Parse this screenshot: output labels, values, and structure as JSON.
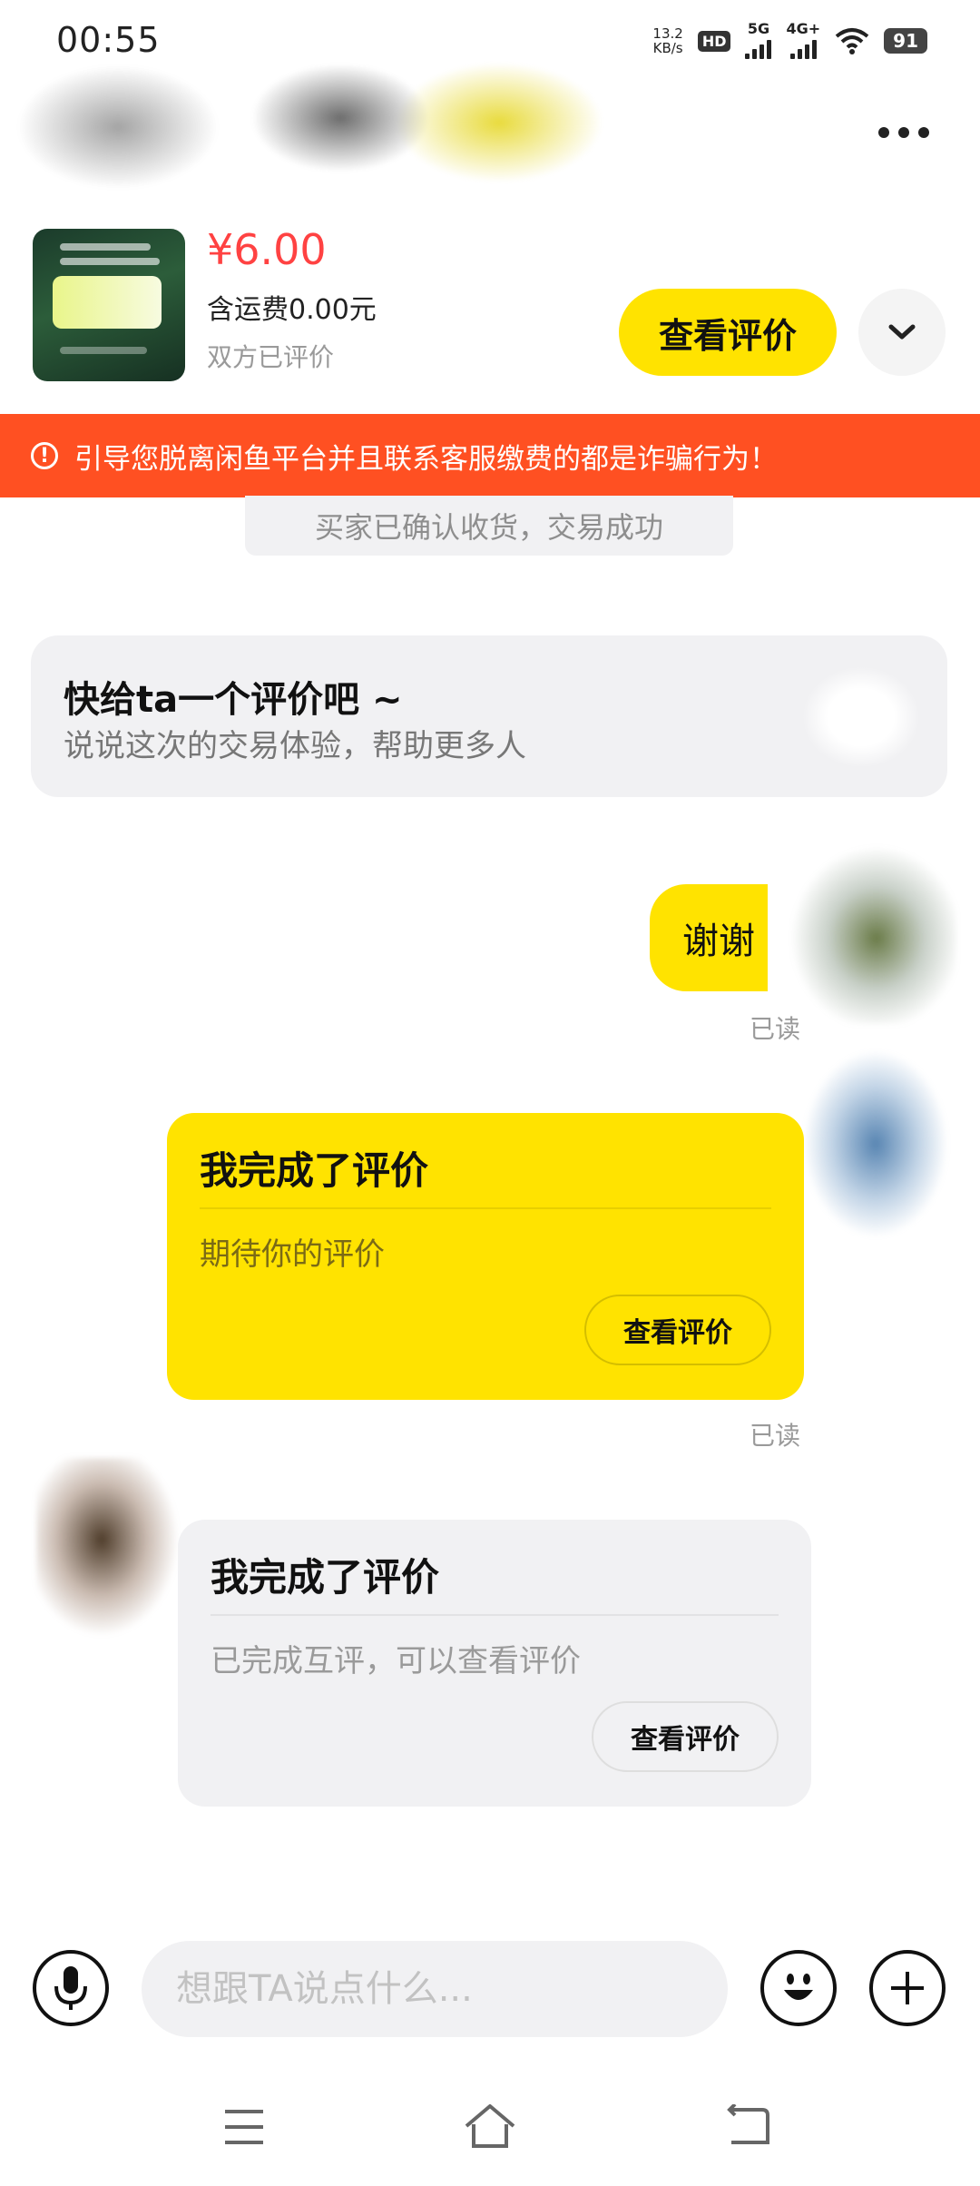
{
  "status_bar": {
    "time": "00:55",
    "net_speed_value": "13.2",
    "net_speed_unit": "KB/s",
    "hd_badge": "HD",
    "signal_1_label": "5G",
    "signal_2_label": "4G+",
    "battery": "91"
  },
  "product": {
    "price": "¥6.00",
    "shipping": "含运费0.00元",
    "status": "双方已评价",
    "view_review_label": "查看评价"
  },
  "warning": {
    "text": "引导您脱离闲鱼平台并且联系客服缴费的都是诈骗行为！"
  },
  "system_notice": "买家已确认收货，交易成功",
  "prompt_card": {
    "title": "快给ta一个评价吧 ~",
    "subtitle": "说说这次的交易体验，帮助更多人"
  },
  "messages": {
    "text_message": "谢谢",
    "read_label_1": "已读",
    "my_review_card": {
      "title": "我完成了评价",
      "body": "期待你的评价",
      "button": "查看评价"
    },
    "read_label_2": "已读",
    "their_review_card": {
      "title": "我完成了评价",
      "body": "已完成互评，可以查看评价",
      "button": "查看评价"
    }
  },
  "input_bar": {
    "placeholder": "想跟TA说点什么..."
  },
  "icons": {
    "mic": "microphone-icon",
    "emoji": "emoji-icon",
    "plus": "plus-icon",
    "more": "more-icon",
    "dropdown": "chevron-down-icon",
    "warning": "exclamation-icon",
    "nav_menu": "menu-icon",
    "nav_home": "home-icon",
    "nav_back": "back-icon"
  },
  "colors": {
    "accent_yellow": "#ffe300",
    "warning_orange": "#ff5022",
    "price_red": "#ff4242",
    "bubble_gray": "#f1f1f3"
  }
}
